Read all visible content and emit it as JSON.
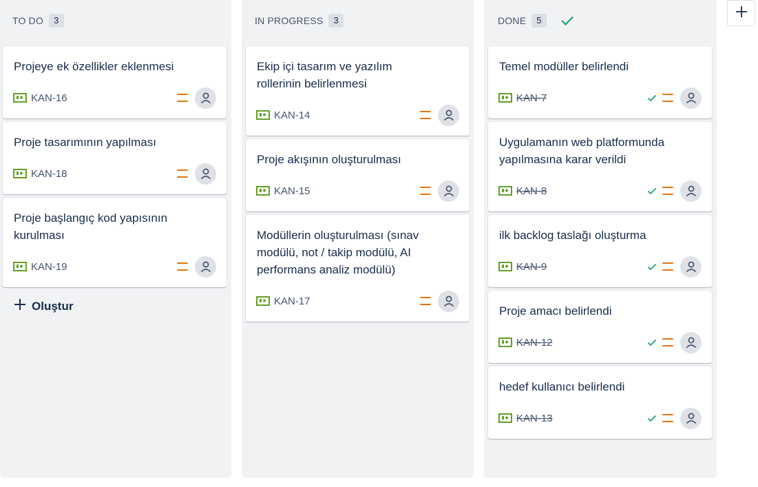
{
  "board": {
    "columns": [
      {
        "name": "TO DO",
        "count": "3",
        "cards": [
          {
            "title": "Projeye ek özellikler eklenmesi",
            "key": "KAN-16"
          },
          {
            "title": "Proje tasarımının yapılması",
            "key": "KAN-18"
          },
          {
            "title": "Proje başlangıç kod yapısının kurulması",
            "key": "KAN-19"
          }
        ]
      },
      {
        "name": "IN PROGRESS",
        "count": "3",
        "cards": [
          {
            "title": "Ekip içi tasarım ve yazılım rollerinin belirlenmesi",
            "key": "KAN-14"
          },
          {
            "title": "Proje akışının oluşturulması",
            "key": "KAN-15"
          },
          {
            "title": "Modüllerin oluşturulması (sınav modülü, not / takip modülü, AI performans analiz modülü)",
            "key": "KAN-17"
          }
        ]
      },
      {
        "name": "DONE",
        "count": "5",
        "cards": [
          {
            "title": "Temel modüller belirlendi",
            "key": "KAN-7"
          },
          {
            "title": "Uygulamanın web platformunda yapılmasına karar verildi",
            "key": "KAN-8"
          },
          {
            "title": "ilk backlog taslağı oluşturma",
            "key": "KAN-9"
          },
          {
            "title": "Proje amacı belirlendi",
            "key": "KAN-12"
          },
          {
            "title": "hedef kullanıcı belirlendi",
            "key": "KAN-13"
          }
        ]
      }
    ],
    "create_label": "Oluştur"
  },
  "icons": {
    "issue_type": "story-icon",
    "priority": "priority-medium-icon",
    "assignee": "unassigned-avatar-icon",
    "done": "check-icon",
    "add_column": "plus-icon"
  },
  "colors": {
    "story_icon": "#63a022",
    "priority_medium": "#e2740f",
    "done_check": "#22a06b",
    "column_bg": "#f1f2f4"
  }
}
